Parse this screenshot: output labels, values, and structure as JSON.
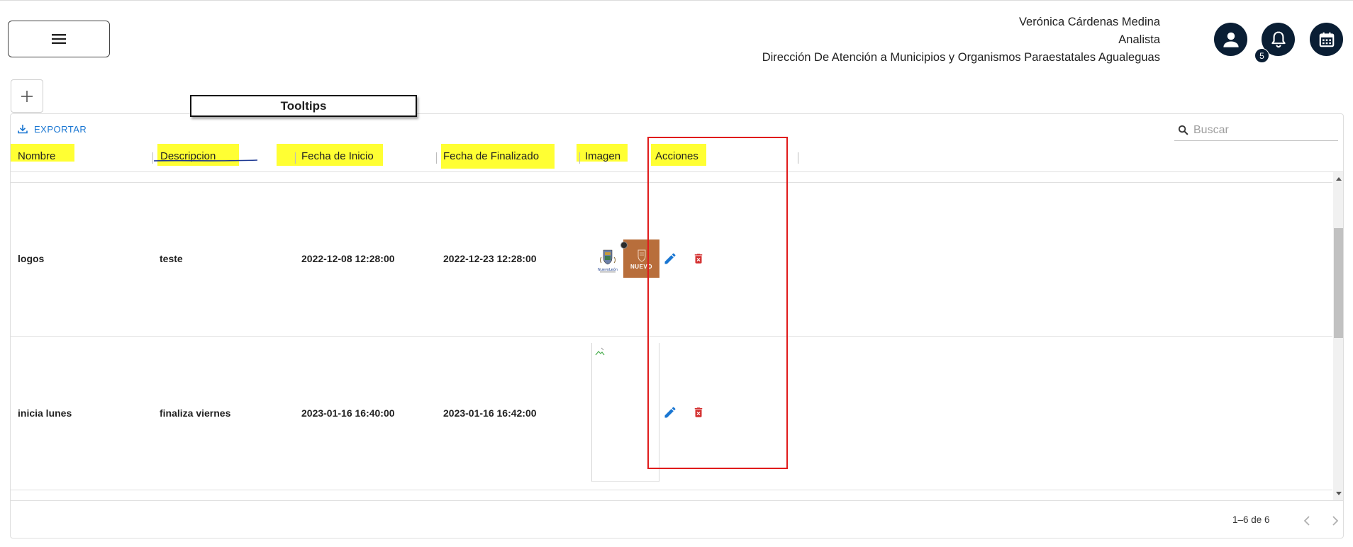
{
  "header": {
    "user_name": "Verónica Cárdenas Medina",
    "user_role": "Analista",
    "user_department": "Dirección De Atención a Municipios y Organismos Paraestatales Agualeguas",
    "notification_count": "5",
    "icons": [
      "menu-icon",
      "account-icon",
      "bell-icon",
      "calendar-icon"
    ],
    "accent_color": "#0a1e34"
  },
  "annotation": {
    "tooltips_label": "Tooltips"
  },
  "toolbar": {
    "export_label": "EXPORTAR",
    "search_placeholder": "Buscar"
  },
  "table": {
    "columns": [
      "Nombre",
      "Descripcion",
      "Fecha de Inicio",
      "Fecha de Finalizado",
      "Imagen",
      "Acciones"
    ],
    "rows": [
      {
        "nombre": "logos",
        "descripcion": "teste",
        "fecha_inicio": "2022-12-08 12:28:00",
        "fecha_fin": "2022-12-23 12:28:00",
        "imagen_card_text": "NUEVO",
        "imagen_logo_text": "NuevoLeón"
      },
      {
        "nombre": "inicia lunes",
        "descripcion": "finaliza viernes",
        "fecha_inicio": "2023-01-16 16:40:00",
        "fecha_fin": "2023-01-16 16:42:00",
        "imagen_card_text": "",
        "imagen_logo_text": ""
      }
    ],
    "highlight_color": "#ffff33",
    "edit_color": "#1976d2",
    "delete_color": "#d32f2f"
  },
  "pagination": {
    "label": "1–6 de 6"
  }
}
